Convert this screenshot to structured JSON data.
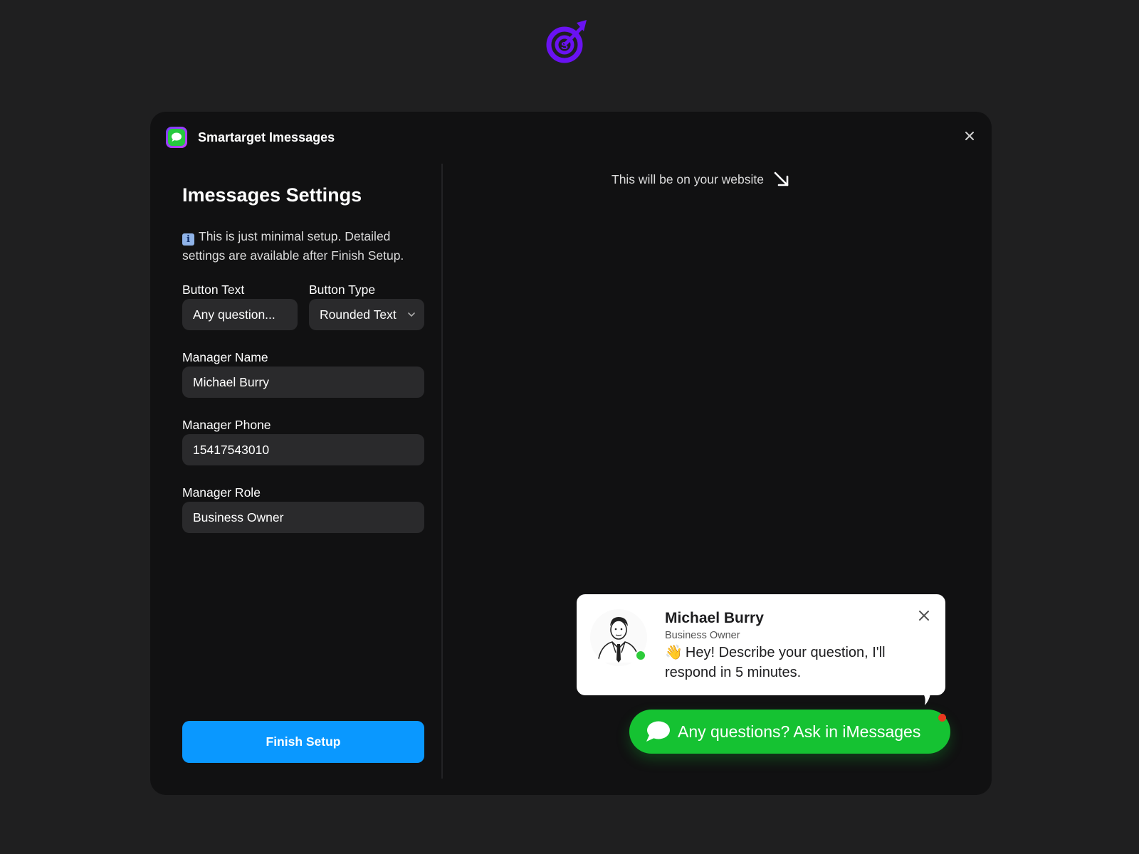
{
  "app": {
    "title": "Smartarget Imessages",
    "icon": "imessages-app-icon",
    "logo_icon": "smartarget-target-logo-icon",
    "brand_color": "#6a12f2"
  },
  "settings": {
    "title": "Imessages Settings",
    "info_icon": "info-icon",
    "info_note": "This is just minimal setup. Detailed settings are available after Finish Setup.",
    "button_text": {
      "label": "Button Text",
      "value": "Any question..."
    },
    "button_type": {
      "label": "Button Type",
      "value": "Rounded Text"
    },
    "manager_name": {
      "label": "Manager Name",
      "value": "Michael Burry"
    },
    "manager_phone": {
      "label": "Manager Phone",
      "value": "15417543010"
    },
    "manager_role": {
      "label": "Manager Role",
      "value": "Business Owner"
    },
    "finish_label": "Finish Setup",
    "finish_color": "#0a98ff"
  },
  "preview": {
    "caption": "This will be on your website",
    "popup": {
      "name": "Michael Burry",
      "role": "Business Owner",
      "wave": "👋",
      "message": "Hey! Describe your question, I'll respond in 5 minutes."
    },
    "cta": {
      "label": "Any questions? Ask in iMessages",
      "color": "#15c232"
    }
  }
}
